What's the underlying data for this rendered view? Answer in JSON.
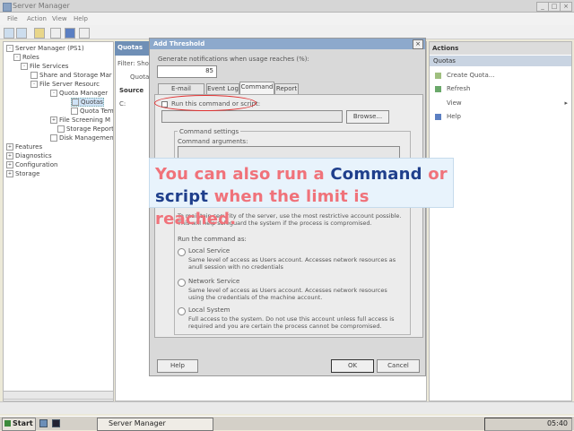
{
  "window": {
    "title": "Server Manager",
    "controls": [
      "_",
      "□",
      "×"
    ]
  },
  "menu": {
    "items": [
      "File",
      "Action",
      "View",
      "Help"
    ]
  },
  "tree": {
    "items": [
      {
        "label": "Server Manager (PS1)",
        "indent": 0,
        "expander": "-",
        "icon": "server-icon"
      },
      {
        "label": "Roles",
        "indent": 1,
        "expander": "-",
        "icon": "roles-icon"
      },
      {
        "label": "File Services",
        "indent": 2,
        "expander": "-",
        "icon": "folder-icon"
      },
      {
        "label": "Share and Storage Mar",
        "indent": 3,
        "expander": "",
        "icon": "share-icon"
      },
      {
        "label": "File Server Resourc",
        "indent": 3,
        "expander": "-",
        "icon": "folder-icon"
      },
      {
        "label": "Quota Manager",
        "indent": 4,
        "expander": "-",
        "icon": "quota-icon"
      },
      {
        "label": "Quotas",
        "indent": 5,
        "expander": "",
        "icon": "quotas-icon",
        "selected": true
      },
      {
        "label": "Quota Tem",
        "indent": 5,
        "expander": "",
        "icon": "template-icon"
      },
      {
        "label": "File Screening M",
        "indent": 4,
        "expander": "+",
        "icon": "screen-icon"
      },
      {
        "label": "Storage Report",
        "indent": 4,
        "expander": "",
        "icon": "report-icon"
      },
      {
        "label": "Disk Management",
        "indent": 3,
        "expander": "",
        "icon": "disk-icon"
      },
      {
        "label": "Features",
        "indent": 0,
        "expander": "+",
        "icon": "features-icon"
      },
      {
        "label": "Diagnostics",
        "indent": 0,
        "expander": "+",
        "icon": "diagnostics-icon"
      },
      {
        "label": "Configuration",
        "indent": 0,
        "expander": "+",
        "icon": "configuration-icon"
      },
      {
        "label": "Storage",
        "indent": 0,
        "expander": "+",
        "icon": "storage-icon"
      }
    ]
  },
  "middle": {
    "header": "Quotas",
    "filter_label": "Filter: Show",
    "row1": "Quota",
    "source_label": "Source",
    "row2": "C:"
  },
  "actions": {
    "header": "Actions",
    "subheader": "Quotas",
    "items": [
      {
        "label": "Create Quota...",
        "icon": "create-quota-icon"
      },
      {
        "label": "Refresh",
        "icon": "refresh-icon"
      },
      {
        "label": "View",
        "icon": "view-icon",
        "submenu": "▸"
      },
      {
        "label": "Help",
        "icon": "help-icon"
      }
    ]
  },
  "dialog": {
    "title": "Add Threshold",
    "close": "×",
    "usage_label": "Generate notifications when usage reaches (%):",
    "usage_value": "85",
    "tabs": [
      "E-mail Message",
      "Event Log",
      "Command",
      "Report"
    ],
    "active_tab": "Command",
    "run_checkbox_label": "Run this command or script:",
    "browse": "Browse...",
    "command_settings": "Command settings",
    "command_arguments": "Command arguments:",
    "security_text": "To maintain security of the server, use the most restrictive account possible. This will help safeguard the system if the process is compromised.",
    "run_as": "Run the command as:",
    "options": [
      {
        "label": "Local Service",
        "desc": "Same level of access as Users account. Accesses network resources as anull session with no credentials"
      },
      {
        "label": "Network Service",
        "desc": "Same level of access as Users account. Accesses network resources using the credentials of the machine account."
      },
      {
        "label": "Local System",
        "desc": "Full access to the system. Do not use this account unless full access is required and you are certain the process cannot be compromised."
      }
    ],
    "help": "Help",
    "ok": "OK",
    "cancel": "Cancel"
  },
  "callout": {
    "part1": "You can also run a ",
    "part2": "Command",
    "part3": " or",
    "part4": "script",
    "part5": " when the limit is reached."
  },
  "taskbar": {
    "start": "Start",
    "task": "Server Manager",
    "clock": "05:40"
  },
  "colors": {
    "dialog_title": "#8da9cc",
    "callout_bg": "#e8f3fc",
    "callout_pink": "#f0727a",
    "callout_navy": "#1f3f8c",
    "highlight_circle": "#e03030"
  }
}
